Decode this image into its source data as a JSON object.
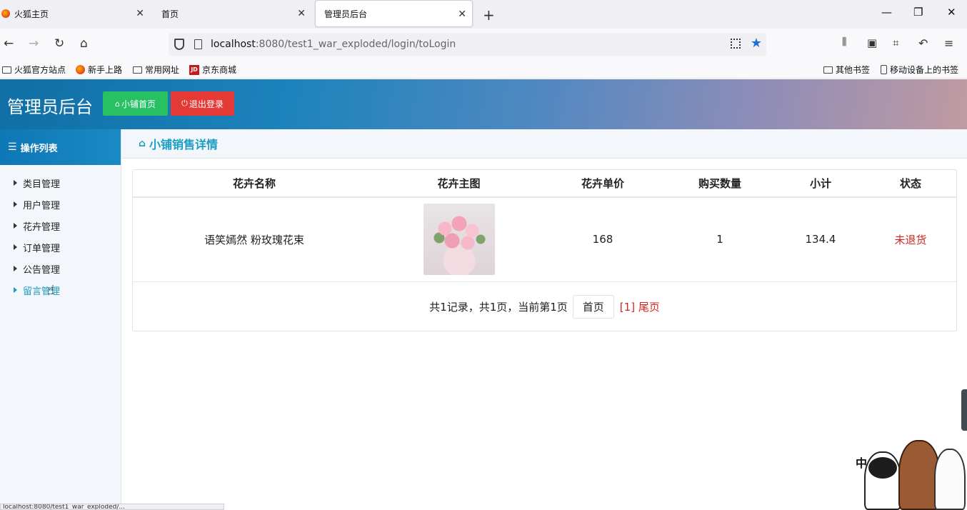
{
  "browser": {
    "tabs": [
      {
        "label": "火狐主页"
      },
      {
        "label": "首页"
      },
      {
        "label": "管理员后台"
      }
    ],
    "close_glyph": "✕",
    "new_tab_glyph": "+",
    "window_controls": {
      "minimize": "—",
      "restore": "❐",
      "close": "✕"
    },
    "url_host": "localhost",
    "url_rest": ":8080/test1_war_exploded/login/toLogin",
    "bookmarks": [
      "火狐官方站点",
      "新手上路",
      "常用网址",
      "京东商城"
    ],
    "bookmarks_right": [
      "其他书签",
      "移动设备上的书签"
    ],
    "jd_logo": "JD"
  },
  "header": {
    "title": "管理员后台",
    "home_button": "小铺首页",
    "logout_button": "退出登录"
  },
  "sidebar": {
    "title": "操作列表",
    "items": [
      {
        "label": "类目管理"
      },
      {
        "label": "用户管理"
      },
      {
        "label": "花卉管理"
      },
      {
        "label": "订单管理"
      },
      {
        "label": "公告管理"
      },
      {
        "label": "留言管理"
      }
    ]
  },
  "main": {
    "breadcrumb": "小铺销售详情",
    "table": {
      "headers": [
        "花卉名称",
        "花卉主图",
        "花卉单价",
        "购买数量",
        "小计",
        "状态"
      ],
      "rows": [
        {
          "name": "语笑嫣然 粉玫瑰花束",
          "price": "168",
          "qty": "1",
          "subtotal": "134.4",
          "status": "未退货"
        }
      ]
    },
    "pager": {
      "summary": "共1记录，共1页，当前第1页",
      "first": "首页",
      "links": "[1] 尾页"
    }
  },
  "decor": {
    "badge_text": "中"
  },
  "status_bar": {
    "url": "localhost:8080/test1_war_exploded/..."
  },
  "colors": {
    "accent": "#1a9dc2",
    "success": "#27c164",
    "danger": "#e53935"
  }
}
